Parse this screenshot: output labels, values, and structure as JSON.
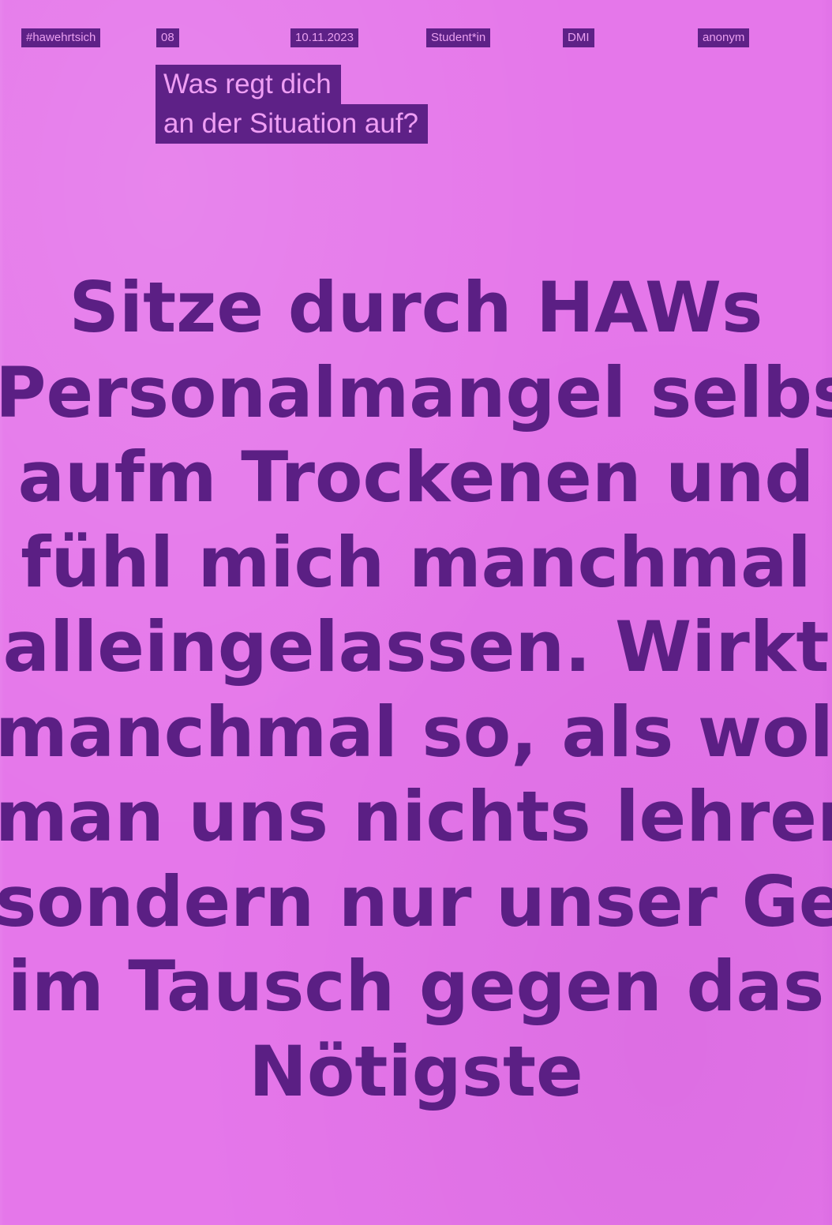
{
  "header_tags": [
    "#hawehrtsich",
    "08",
    "10.11.2023",
    "Student*in",
    "DMI",
    "anonym"
  ],
  "question": {
    "line1": "Was regt dich",
    "line2": "an der Situation auf?"
  },
  "statement_lines": [
    "Sitze durch HAWs",
    "Personalmangel selbst",
    "aufm Trockenen und",
    "fühl mich manchmal",
    "alleingelassen. Wirkt",
    "manchmal so, als wolle",
    "man uns nichts lehren,",
    "sondern nur unser Geld",
    "im Tausch gegen das",
    "Nötigste"
  ],
  "colors": {
    "paper": "#e577ea",
    "ink": "#5b1f84",
    "tag_text": "#ea9ff0"
  }
}
